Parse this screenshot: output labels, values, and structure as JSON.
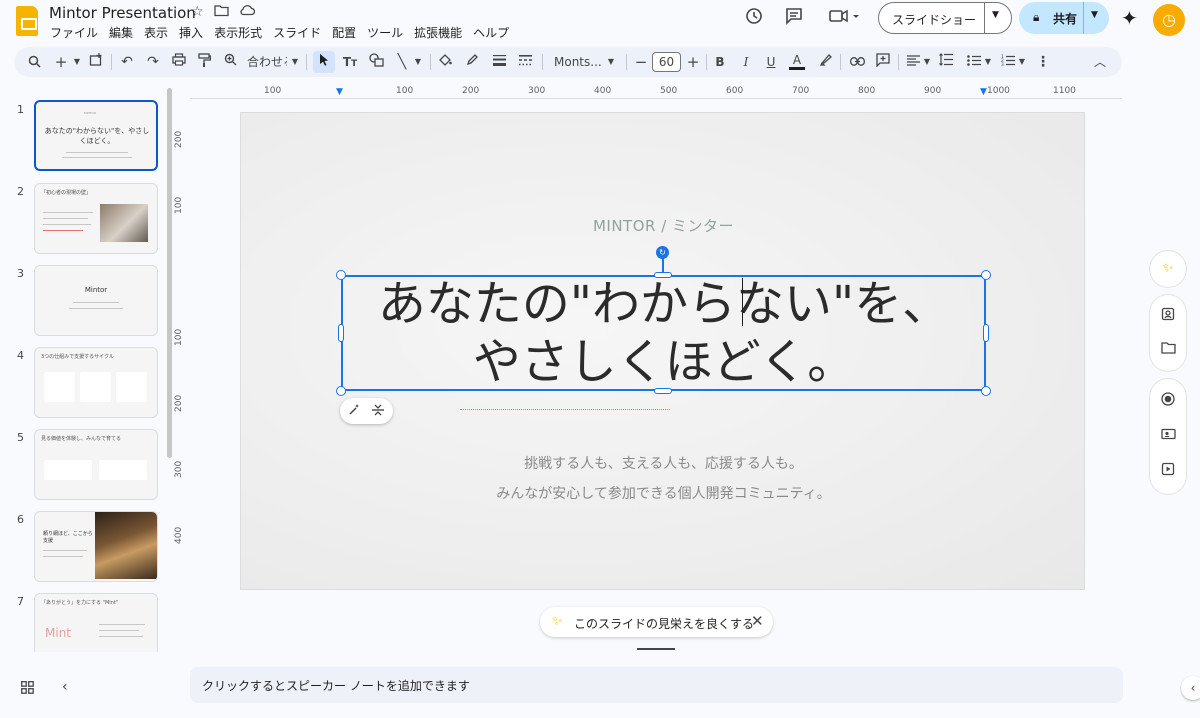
{
  "app": {
    "doc_title": "Mintor Presentation",
    "menu": [
      "ファイル",
      "編集",
      "表示",
      "挿入",
      "表示形式",
      "スライド",
      "配置",
      "ツール",
      "拡張機能",
      "ヘルプ"
    ],
    "slideshow_label": "スライドショー",
    "share_label": "共有"
  },
  "toolbar": {
    "zoom_label": "合わせる",
    "font_name": "Monts...",
    "font_size": "60"
  },
  "rulers": {
    "h_ticks": [
      "100",
      "100",
      "200",
      "300",
      "400",
      "500",
      "600",
      "700",
      "800",
      "900",
      "1000",
      "1100"
    ],
    "v_ticks": [
      "200",
      "100",
      "100",
      "200",
      "300",
      "400"
    ]
  },
  "filmstrip": {
    "slides": [
      {
        "num": "1",
        "title": "あなたの\"わからない\"を、やさしくほどく。"
      },
      {
        "num": "2",
        "title": "「初心者の現場の壁」"
      },
      {
        "num": "3",
        "title": "Mintor"
      },
      {
        "num": "4",
        "title": "3つの仕組みで支援するサイクル"
      },
      {
        "num": "5",
        "title": "見る価値を体験し、みんなで育てる"
      },
      {
        "num": "6",
        "title": "頼り網ほど、ここから支援"
      },
      {
        "num": "7",
        "title": "「ありがとう」を力にする \"Mint\""
      }
    ],
    "slide7_brand": "Mint"
  },
  "slide": {
    "brand": "MINTOR / ミンター",
    "headline_line1": "あなたの\"わからない\"を、",
    "headline_line2": "やさしくほどく。",
    "subtitle_line1": "挑戦する人も、支える人も、応援する人も。",
    "subtitle_line2": "みんなが安心して参加できる個人開発コミュニティ。"
  },
  "bottom": {
    "improve_label": "このスライドの見栄えを良くする",
    "notes_placeholder": "クリックするとスピーカー ノートを追加できます"
  },
  "colors": {
    "accent": "#0b57d0",
    "share_bg": "#c2e7ff",
    "avatar": "#f9ab00",
    "brand_text": "#93a39b"
  }
}
